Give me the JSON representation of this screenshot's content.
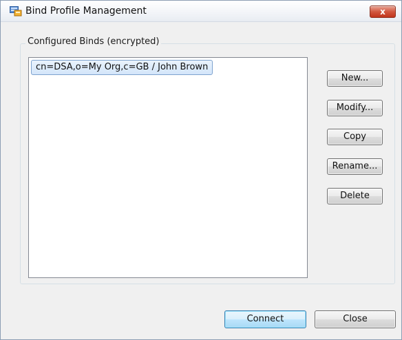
{
  "window": {
    "title": "Bind Profile Management",
    "close_symbol": "x"
  },
  "group": {
    "title": "Configured Binds (encrypted)"
  },
  "binds": [
    {
      "label": "cn=DSA,o=My Org,c=GB / John Brown",
      "selected": true
    }
  ],
  "side_buttons": {
    "new": "New...",
    "modify": "Modify...",
    "copy": "Copy",
    "rename": "Rename...",
    "delete": "Delete"
  },
  "footer": {
    "connect": "Connect",
    "close": "Close"
  },
  "colors": {
    "selection_border": "#7da2ce",
    "selection_fill": "#d3e5fa",
    "close_button": "#c0341c",
    "default_button_border": "#3c7fb1"
  },
  "icons": {
    "app": "bind-profile-app-icon",
    "close": "close-icon"
  }
}
